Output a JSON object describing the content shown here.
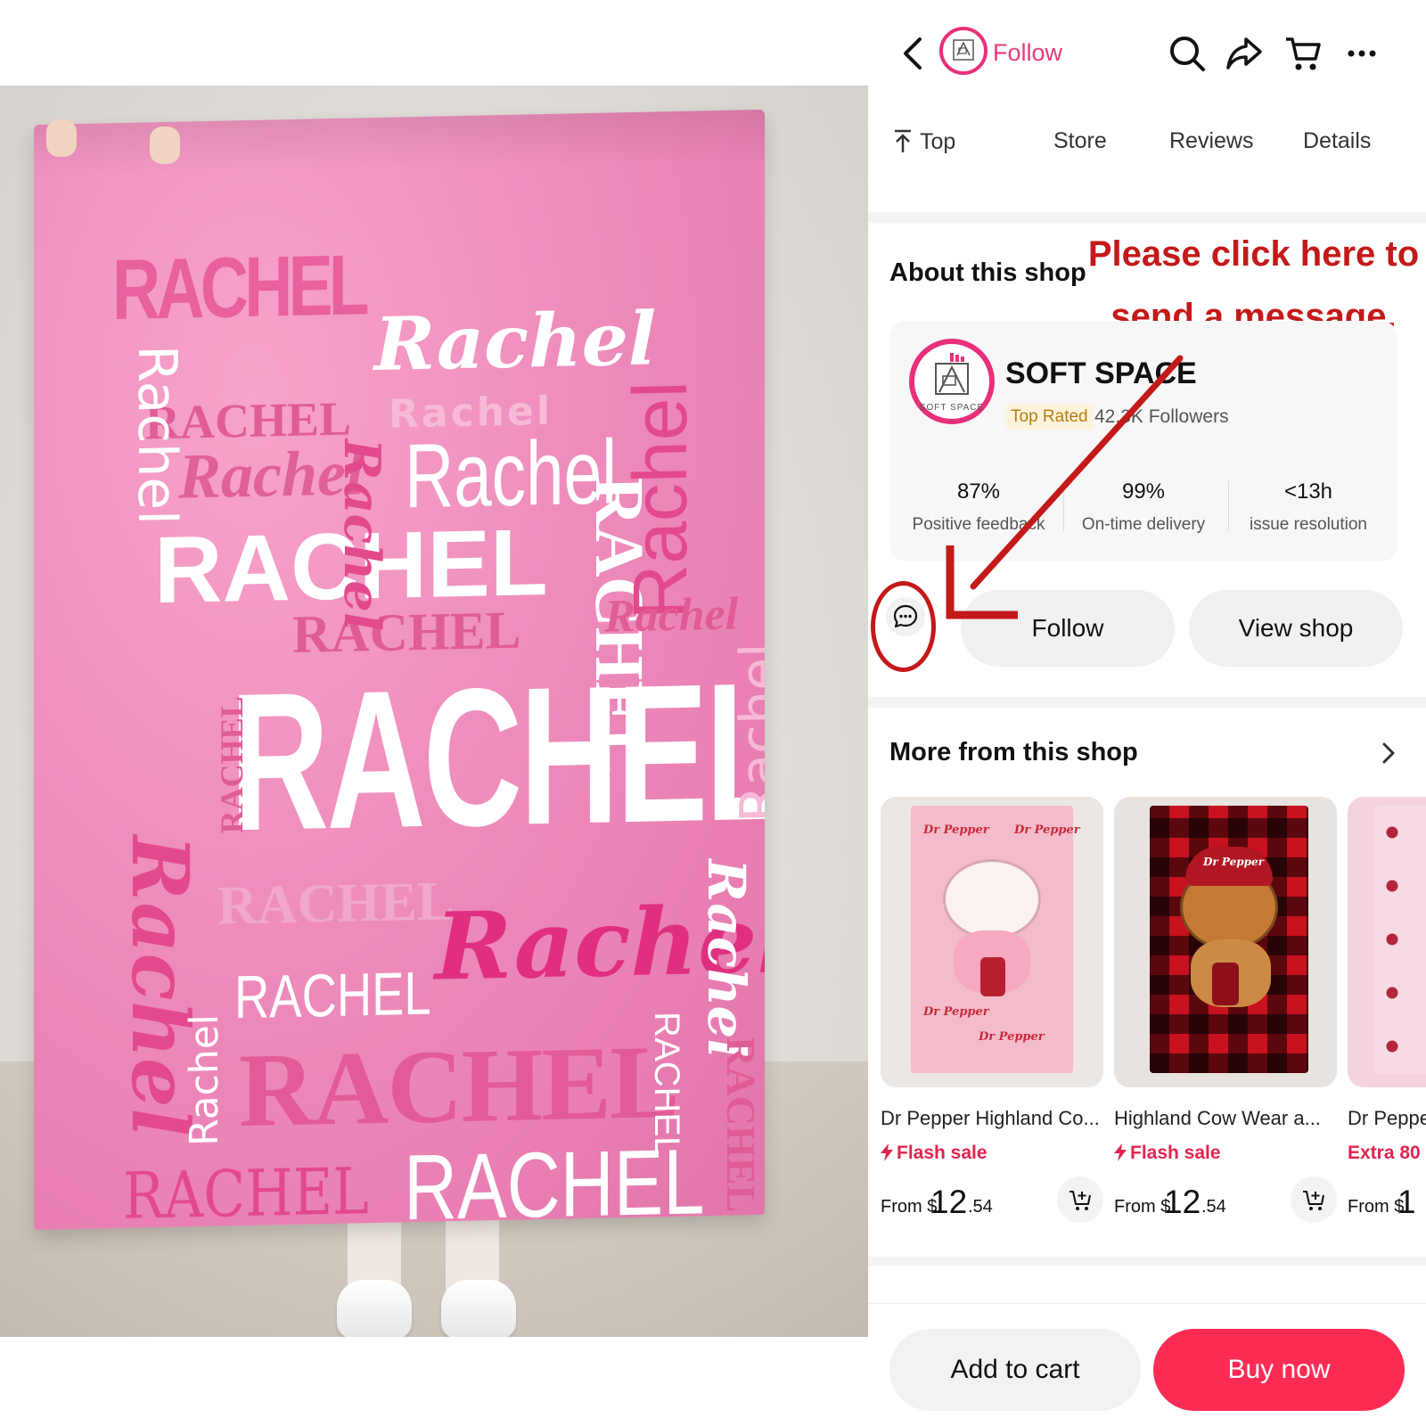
{
  "product_photo": {
    "blanket_words": [
      "RACHEL",
      "Rachel",
      "RACHEL",
      "Rachel",
      "Rachel",
      "Rachel",
      "RACHEL",
      "Rachel",
      "Rachel",
      "RACHEL",
      "RACHEL",
      "Rachel",
      "RACHEL",
      "Rachel",
      "Rachel",
      "RACHEL",
      "RACHEL",
      "Rachel",
      "Rachel",
      "RACHEL",
      "RACHEL",
      "RACHEL",
      "RACHEL",
      "Rachel",
      "RACHEL",
      "RACHEL",
      "Rachel"
    ]
  },
  "header": {
    "follow_label": "Follow",
    "logo_text": "SOFT SPACE",
    "icons": [
      "chevron-left-icon",
      "search-icon",
      "share-icon",
      "cart-icon",
      "more-icon"
    ]
  },
  "tabs": [
    {
      "label": "Top",
      "icon": "arrow-up-to-top-icon"
    },
    {
      "label": "Store"
    },
    {
      "label": "Reviews"
    },
    {
      "label": "Details"
    }
  ],
  "about": {
    "title": "About this shop",
    "annotation_line1": "Please click here to",
    "annotation_line2": "send a message.",
    "annotation_color": "#c41919",
    "shop_name": "SOFT SPACE",
    "badge": "Top Rated",
    "followers": "42.3K Followers",
    "stats": [
      {
        "value": "87%",
        "label": "Positive feedback"
      },
      {
        "value": "99%",
        "label": "On-time delivery"
      },
      {
        "value": "<13h",
        "label": "issue resolution"
      }
    ],
    "follow_button": "Follow",
    "view_shop_button": "View shop"
  },
  "more": {
    "title": "More from this shop",
    "products": [
      {
        "title": "Dr Pepper Highland Co...",
        "promo": "Flash sale",
        "from": "From $",
        "price_int": "12",
        "price_cents": ".54",
        "image_text": "Dr Pepper"
      },
      {
        "title": "Highland Cow Wear a...",
        "promo": "Flash sale",
        "from": "From $",
        "price_int": "12",
        "price_cents": ".54",
        "image_text": "Dr Pepper"
      },
      {
        "title": "Dr Peppe",
        "promo": "Extra 80",
        "from": "From $",
        "price_int": "1",
        "price_cents": ""
      }
    ]
  },
  "bottom": {
    "add_to_cart": "Add to cart",
    "buy_now": "Buy now",
    "brand_color": "#fe2c55"
  }
}
